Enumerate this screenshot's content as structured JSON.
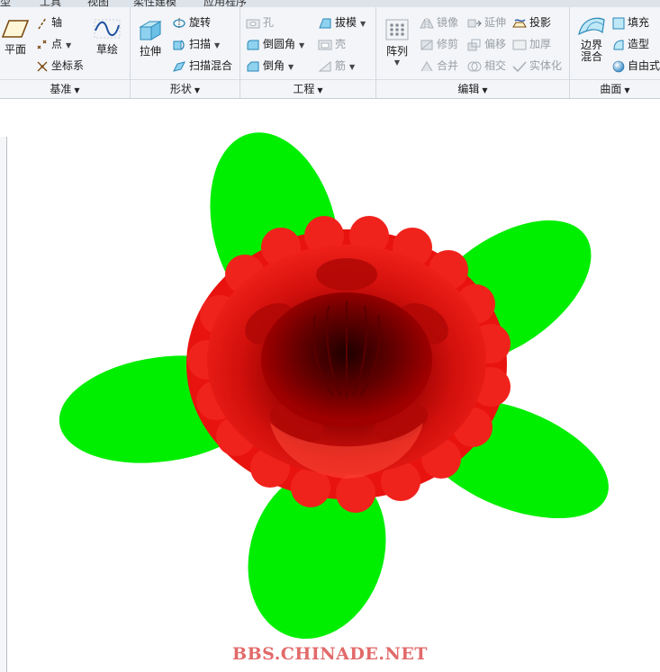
{
  "tabs": [
    "模型",
    "工具",
    "视图",
    "柔性建模",
    "应用程序"
  ],
  "groups": {
    "datum": {
      "label": "基准",
      "plane": "平面",
      "axis": "轴",
      "point": "点",
      "csys": "坐标系",
      "sketch": "草绘"
    },
    "shapes": {
      "label": "形状",
      "extrude": "拉伸",
      "revolve": "旋转",
      "sweep": "扫描",
      "swept_blend": "扫描混合"
    },
    "engineering": {
      "label": "工程",
      "hole": "孔",
      "draft": "拔模",
      "round": "倒圆角",
      "shell": "壳",
      "chamfer": "倒角",
      "rib": "筋"
    },
    "editing": {
      "label": "编辑",
      "pattern": "阵列",
      "mirror": "镜像",
      "extend": "延伸",
      "project": "投影",
      "trim": "修剪",
      "offset": "偏移",
      "thicken": "加厚",
      "merge": "合并",
      "intersect": "相交",
      "solidify": "实体化"
    },
    "surfaces": {
      "label": "曲面",
      "boundary_blend": "边界混合",
      "fill": "填充",
      "style": "造型",
      "freestyle": "自由式"
    }
  },
  "colors": {
    "petal": "#00ee00",
    "flower": "#e8130f",
    "flower_dark": "#8a0000",
    "watermark": "#e26a6a"
  },
  "watermark": "BBS.CHINADE.NET"
}
